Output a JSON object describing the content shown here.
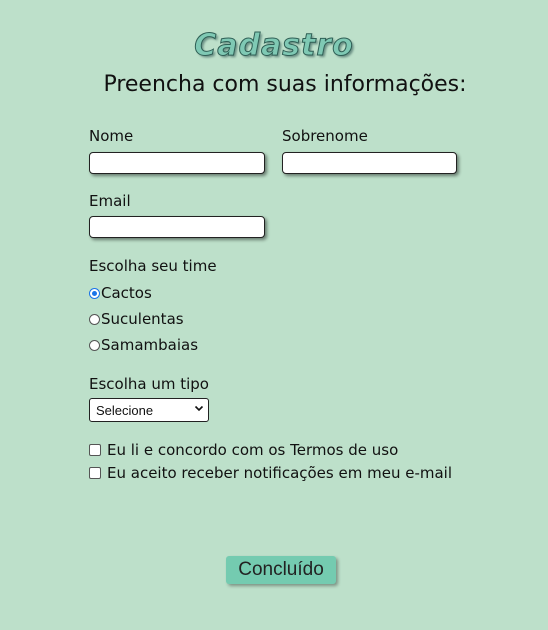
{
  "header": {
    "title": "Cadastro",
    "subtitle": "Preencha com suas informações:"
  },
  "form": {
    "nome_label": "Nome",
    "nome_value": "",
    "sobrenome_label": "Sobrenome",
    "sobrenome_value": "",
    "email_label": "Email",
    "email_value": "",
    "time_label": "Escolha seu time",
    "time_options": [
      "Cactos",
      "Suculentas",
      "Samambaias"
    ],
    "time_selected": "Cactos",
    "tipo_label": "Escolha um tipo",
    "tipo_selected": "Selecione",
    "terms_label": "Eu li e concordo com os Termos de uso",
    "terms_checked": false,
    "notify_label": "Eu aceito receber notificações em meu e-mail",
    "notify_checked": false,
    "submit_label": "Concluído"
  },
  "colors": {
    "background": "#bde0ca",
    "title": "#7fc9b4",
    "button": "#74cbb0",
    "radio_checked": "#1a73e8"
  },
  "icons": {
    "select_arrow": "chevron-down-icon"
  }
}
